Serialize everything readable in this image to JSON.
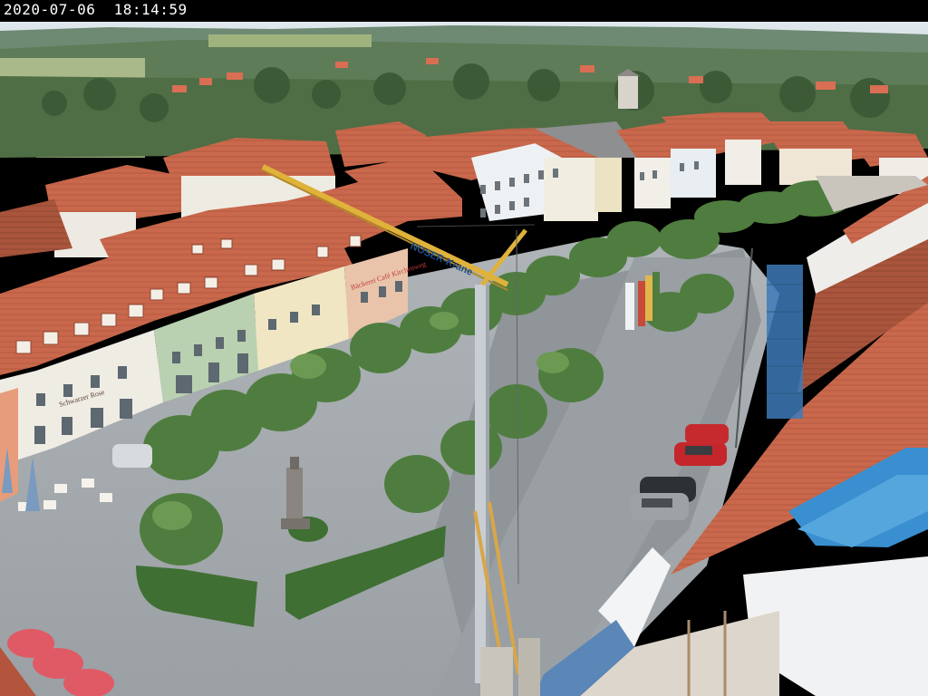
{
  "camera": {
    "timestamp": "2020-07-06  18:14:59"
  },
  "scene": {
    "crane_brand": "NOSER-Krane",
    "shop_sign_left": "Schwarzer Rose",
    "shop_sign_mid": "Bäckerei Café Kirchenweg"
  }
}
